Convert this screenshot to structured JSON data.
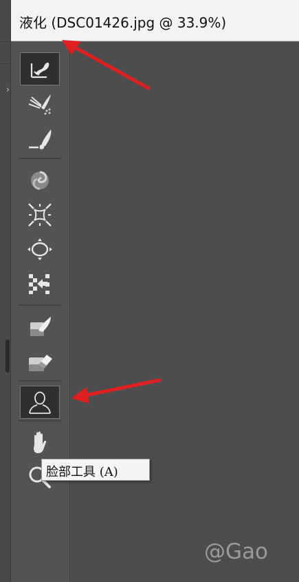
{
  "window": {
    "title": "液化 (DSC01426.jpg @ 33.9%)"
  },
  "toolbar": {
    "tools": [
      {
        "name": "forward-warp-tool-icon",
        "active": true
      },
      {
        "name": "reconstruct-tool-icon"
      },
      {
        "name": "smooth-tool-icon"
      },
      {
        "name": "twirl-tool-icon"
      },
      {
        "name": "pucker-tool-icon"
      },
      {
        "name": "bloat-tool-icon"
      },
      {
        "name": "push-left-tool-icon"
      },
      {
        "name": "freeze-mask-tool-icon"
      },
      {
        "name": "thaw-mask-tool-icon"
      },
      {
        "name": "face-tool-icon",
        "active": true
      },
      {
        "name": "hand-tool-icon"
      },
      {
        "name": "zoom-tool-icon"
      }
    ]
  },
  "tooltip": {
    "text": "脸部工具 (A)"
  },
  "watermark": {
    "text": "@Gao"
  },
  "annotations": {
    "arrow_color": "#e02020"
  },
  "colors": {
    "panel": "#535353",
    "canvas": "#4d4d4d",
    "titlebar": "#f3f3f3",
    "icon": "#e6e6e6"
  }
}
